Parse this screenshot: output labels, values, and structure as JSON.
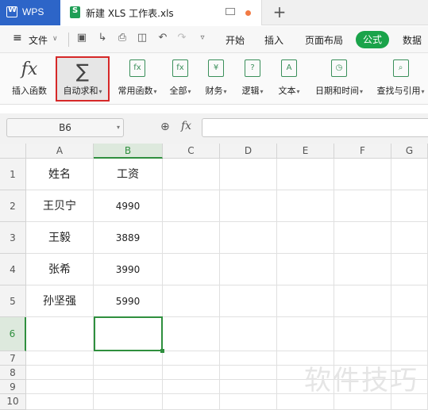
{
  "titlebar": {
    "app_tab": "WPS",
    "doc_tab": "新建 XLS 工作表.xls",
    "new_tab": "+"
  },
  "menubar": {
    "file": "文件",
    "tabs": [
      "开始",
      "插入",
      "页面布局",
      "公式",
      "数据"
    ],
    "active_tab": "公式"
  },
  "ribbon": {
    "insert_function": "插入函数",
    "autosum": "自动求和",
    "common_functions": "常用函数",
    "all": "全部",
    "finance": "财务",
    "logic": "逻辑",
    "text": "文本",
    "datetime": "日期和时间",
    "lookup": "查找与引用"
  },
  "formula_bar": {
    "cell_ref": "B6",
    "fx": "fx",
    "value": ""
  },
  "sheet": {
    "columns": [
      "A",
      "B",
      "C",
      "D",
      "E",
      "F",
      "G"
    ],
    "rows": [
      "1",
      "2",
      "3",
      "4",
      "5",
      "6",
      "7",
      "8",
      "9",
      "10"
    ],
    "cells": {
      "A1": "姓名",
      "B1": "工资",
      "A2": "王贝宁",
      "B2": "4990",
      "A3": "王毅",
      "B3": "3889",
      "A4": "张希",
      "B4": "3990",
      "A5": "孙坚强",
      "B5": "5990"
    },
    "selected_cell": "B6"
  },
  "watermark": "软件技巧",
  "colors": {
    "accent_green": "#1aa34a",
    "wps_blue": "#2d65c8",
    "highlight_red": "#d62828"
  }
}
